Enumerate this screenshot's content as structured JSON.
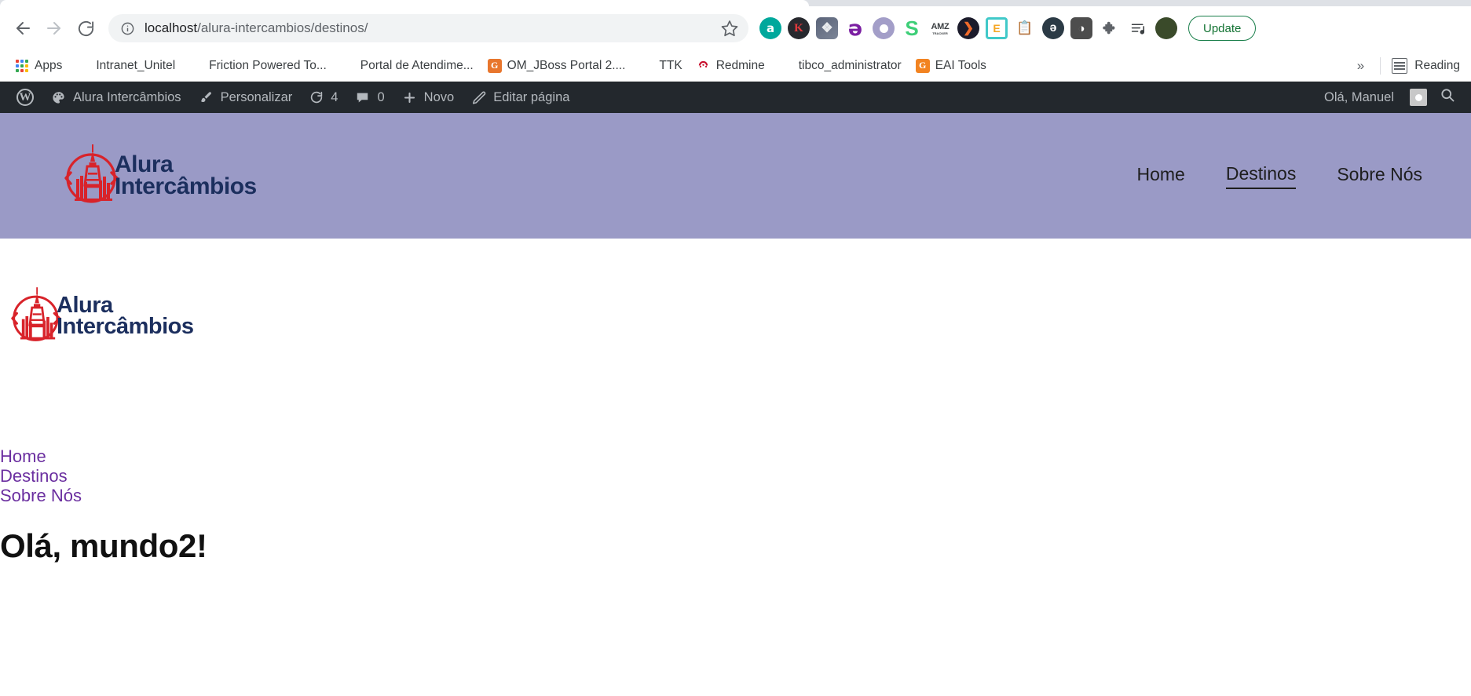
{
  "browser": {
    "nav": {
      "back": "back-arrow",
      "forward": "forward-arrow",
      "reload": "reload"
    },
    "omnibox": {
      "info_icon": "site-information-icon",
      "url_host": "localhost",
      "url_path": "/alura-intercambios/destinos/",
      "url_full": "localhost/alura-intercambios/destinos/",
      "star_icon": "bookmark-star-icon"
    },
    "extensions": [
      {
        "name": "amazon-assistant-extension",
        "label": "a"
      },
      {
        "name": "keepa-extension",
        "label": "K"
      },
      {
        "name": "puzzle-extension",
        "label": "❖"
      },
      {
        "name": "egrow-extension",
        "label": "ə"
      },
      {
        "name": "purple-dot-extension",
        "label": ""
      },
      {
        "name": "sellics-extension",
        "label": "S"
      },
      {
        "name": "amz-tracker-extension",
        "label": "AMZ",
        "sublabel": "TRACKER"
      },
      {
        "name": "yp-extension",
        "label": "❯"
      },
      {
        "name": "evernote-extension",
        "label": "E"
      },
      {
        "name": "clipboard-extension",
        "label": "📋"
      },
      {
        "name": "ghostery-extension",
        "label": "ə"
      },
      {
        "name": "screencast-extension",
        "label": "◑"
      },
      {
        "name": "extensions-puzzle-icon",
        "label": "❖"
      },
      {
        "name": "playlist-icon",
        "label": "≡♪"
      }
    ],
    "profile_avatar": "profile-avatar",
    "update_button": "Update",
    "bookmarks": [
      {
        "label": "Apps",
        "icon": "apps-grid-icon"
      },
      {
        "label": "Intranet_Unitel",
        "icon": "globe-icon"
      },
      {
        "label": "Friction Powered To...",
        "icon": "globe-icon"
      },
      {
        "label": "Portal de Atendime...",
        "icon": "globe-icon"
      },
      {
        "label": "OM_JBoss Portal 2....",
        "icon": "jboss-icon"
      },
      {
        "label": "TTK",
        "icon": "globe-icon"
      },
      {
        "label": "Redmine",
        "icon": "redmine-icon"
      },
      {
        "label": "tibco_administrator",
        "icon": "globe-icon"
      },
      {
        "label": "EAI Tools",
        "icon": "eai-tools-icon"
      }
    ],
    "overflow_label": "»",
    "reading_list": "Reading"
  },
  "wp_admin_bar": {
    "logo": "W",
    "items": [
      {
        "label": "Alura Intercâmbios",
        "icon": "site-palette-icon"
      },
      {
        "label": "Personalizar",
        "icon": "customize-brush-icon"
      },
      {
        "label": "4",
        "icon": "updates-icon"
      },
      {
        "label": "0",
        "icon": "comments-icon"
      },
      {
        "label": "Novo",
        "icon": "plus-icon"
      },
      {
        "label": "Editar página",
        "icon": "edit-pencil-icon"
      }
    ],
    "greeting": "Olá, Manuel",
    "search_icon": "search-icon"
  },
  "site": {
    "logo": {
      "line1": "Alura",
      "line2": "Intercâmbios",
      "icon": "alura-intercambios-logo"
    },
    "header_nav": [
      {
        "label": "Home",
        "current": false
      },
      {
        "label": "Destinos",
        "current": true
      },
      {
        "label": "Sobre Nós",
        "current": false
      }
    ],
    "header_bg": "#9a9ac6"
  },
  "content": {
    "nav_links": [
      "Home",
      "Destinos",
      "Sobre Nós"
    ],
    "post_title": "Olá, mundo2!",
    "link_color": "#6b2fa0"
  }
}
